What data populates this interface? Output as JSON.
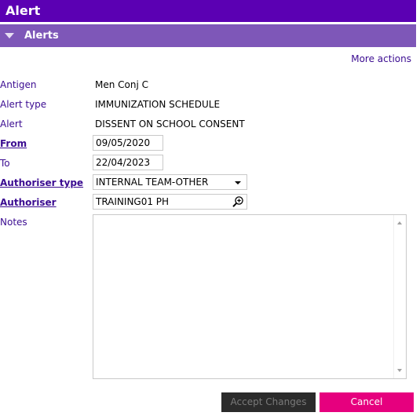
{
  "window": {
    "title": "Alert"
  },
  "section": {
    "title": "Alerts"
  },
  "more_actions": "More actions",
  "fields": {
    "antigen": {
      "label": "Antigen",
      "value": "Men Conj C"
    },
    "alert_type": {
      "label": "Alert type",
      "value": "IMMUNIZATION SCHEDULE"
    },
    "alert": {
      "label": "Alert",
      "value": "DISSENT ON SCHOOL CONSENT"
    },
    "from": {
      "label": "From",
      "value": "09/05/2020"
    },
    "to": {
      "label": "To",
      "value": "22/04/2023"
    },
    "authoriser_type": {
      "label": "Authoriser type",
      "value": "INTERNAL TEAM-OTHER"
    },
    "authoriser": {
      "label": "Authoriser",
      "value": "TRAINING01 PH"
    },
    "notes": {
      "label": "Notes",
      "value": ""
    }
  },
  "buttons": {
    "accept": "Accept Changes",
    "cancel": "Cancel"
  },
  "colors": {
    "titlebar": "#5b00b3",
    "section": "#7e57b8",
    "label": "#3b0c91",
    "cancel": "#e6007e",
    "accept_disabled": "#2b2b2b"
  },
  "icons": {
    "collapse": "triangle-down-icon",
    "lookup": "magnifier-plus-icon",
    "dropdown": "chevron-down-icon"
  }
}
